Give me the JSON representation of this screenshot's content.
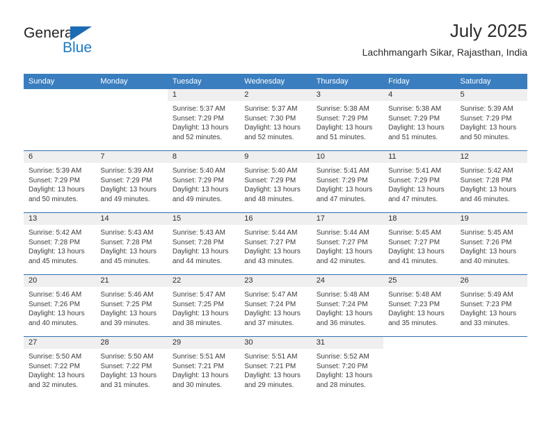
{
  "brand": {
    "name_top": "General",
    "name_bottom": "Blue",
    "accent_color": "#1b7ac4",
    "triangle_color": "#1b6cb5"
  },
  "header": {
    "title": "July 2025",
    "subtitle": "Lachhmangarh Sikar, Rajasthan, India"
  },
  "theme": {
    "header_row_bg": "#3a7ebf",
    "row_divider": "#2f6fae",
    "daynum_band_bg": "#efefef"
  },
  "weekdays": [
    "Sunday",
    "Monday",
    "Tuesday",
    "Wednesday",
    "Thursday",
    "Friday",
    "Saturday"
  ],
  "weeks": [
    [
      {
        "day": "",
        "sunrise": "",
        "sunset": "",
        "daylight_1": "",
        "daylight_2": "",
        "blank": true
      },
      {
        "day": "",
        "sunrise": "",
        "sunset": "",
        "daylight_1": "",
        "daylight_2": "",
        "blank": true
      },
      {
        "day": "1",
        "sunrise": "Sunrise: 5:37 AM",
        "sunset": "Sunset: 7:29 PM",
        "daylight_1": "Daylight: 13 hours",
        "daylight_2": "and 52 minutes."
      },
      {
        "day": "2",
        "sunrise": "Sunrise: 5:37 AM",
        "sunset": "Sunset: 7:30 PM",
        "daylight_1": "Daylight: 13 hours",
        "daylight_2": "and 52 minutes."
      },
      {
        "day": "3",
        "sunrise": "Sunrise: 5:38 AM",
        "sunset": "Sunset: 7:29 PM",
        "daylight_1": "Daylight: 13 hours",
        "daylight_2": "and 51 minutes."
      },
      {
        "day": "4",
        "sunrise": "Sunrise: 5:38 AM",
        "sunset": "Sunset: 7:29 PM",
        "daylight_1": "Daylight: 13 hours",
        "daylight_2": "and 51 minutes."
      },
      {
        "day": "5",
        "sunrise": "Sunrise: 5:39 AM",
        "sunset": "Sunset: 7:29 PM",
        "daylight_1": "Daylight: 13 hours",
        "daylight_2": "and 50 minutes."
      }
    ],
    [
      {
        "day": "6",
        "sunrise": "Sunrise: 5:39 AM",
        "sunset": "Sunset: 7:29 PM",
        "daylight_1": "Daylight: 13 hours",
        "daylight_2": "and 50 minutes."
      },
      {
        "day": "7",
        "sunrise": "Sunrise: 5:39 AM",
        "sunset": "Sunset: 7:29 PM",
        "daylight_1": "Daylight: 13 hours",
        "daylight_2": "and 49 minutes."
      },
      {
        "day": "8",
        "sunrise": "Sunrise: 5:40 AM",
        "sunset": "Sunset: 7:29 PM",
        "daylight_1": "Daylight: 13 hours",
        "daylight_2": "and 49 minutes."
      },
      {
        "day": "9",
        "sunrise": "Sunrise: 5:40 AM",
        "sunset": "Sunset: 7:29 PM",
        "daylight_1": "Daylight: 13 hours",
        "daylight_2": "and 48 minutes."
      },
      {
        "day": "10",
        "sunrise": "Sunrise: 5:41 AM",
        "sunset": "Sunset: 7:29 PM",
        "daylight_1": "Daylight: 13 hours",
        "daylight_2": "and 47 minutes."
      },
      {
        "day": "11",
        "sunrise": "Sunrise: 5:41 AM",
        "sunset": "Sunset: 7:29 PM",
        "daylight_1": "Daylight: 13 hours",
        "daylight_2": "and 47 minutes."
      },
      {
        "day": "12",
        "sunrise": "Sunrise: 5:42 AM",
        "sunset": "Sunset: 7:28 PM",
        "daylight_1": "Daylight: 13 hours",
        "daylight_2": "and 46 minutes."
      }
    ],
    [
      {
        "day": "13",
        "sunrise": "Sunrise: 5:42 AM",
        "sunset": "Sunset: 7:28 PM",
        "daylight_1": "Daylight: 13 hours",
        "daylight_2": "and 45 minutes."
      },
      {
        "day": "14",
        "sunrise": "Sunrise: 5:43 AM",
        "sunset": "Sunset: 7:28 PM",
        "daylight_1": "Daylight: 13 hours",
        "daylight_2": "and 45 minutes."
      },
      {
        "day": "15",
        "sunrise": "Sunrise: 5:43 AM",
        "sunset": "Sunset: 7:28 PM",
        "daylight_1": "Daylight: 13 hours",
        "daylight_2": "and 44 minutes."
      },
      {
        "day": "16",
        "sunrise": "Sunrise: 5:44 AM",
        "sunset": "Sunset: 7:27 PM",
        "daylight_1": "Daylight: 13 hours",
        "daylight_2": "and 43 minutes."
      },
      {
        "day": "17",
        "sunrise": "Sunrise: 5:44 AM",
        "sunset": "Sunset: 7:27 PM",
        "daylight_1": "Daylight: 13 hours",
        "daylight_2": "and 42 minutes."
      },
      {
        "day": "18",
        "sunrise": "Sunrise: 5:45 AM",
        "sunset": "Sunset: 7:27 PM",
        "daylight_1": "Daylight: 13 hours",
        "daylight_2": "and 41 minutes."
      },
      {
        "day": "19",
        "sunrise": "Sunrise: 5:45 AM",
        "sunset": "Sunset: 7:26 PM",
        "daylight_1": "Daylight: 13 hours",
        "daylight_2": "and 40 minutes."
      }
    ],
    [
      {
        "day": "20",
        "sunrise": "Sunrise: 5:46 AM",
        "sunset": "Sunset: 7:26 PM",
        "daylight_1": "Daylight: 13 hours",
        "daylight_2": "and 40 minutes."
      },
      {
        "day": "21",
        "sunrise": "Sunrise: 5:46 AM",
        "sunset": "Sunset: 7:25 PM",
        "daylight_1": "Daylight: 13 hours",
        "daylight_2": "and 39 minutes."
      },
      {
        "day": "22",
        "sunrise": "Sunrise: 5:47 AM",
        "sunset": "Sunset: 7:25 PM",
        "daylight_1": "Daylight: 13 hours",
        "daylight_2": "and 38 minutes."
      },
      {
        "day": "23",
        "sunrise": "Sunrise: 5:47 AM",
        "sunset": "Sunset: 7:24 PM",
        "daylight_1": "Daylight: 13 hours",
        "daylight_2": "and 37 minutes."
      },
      {
        "day": "24",
        "sunrise": "Sunrise: 5:48 AM",
        "sunset": "Sunset: 7:24 PM",
        "daylight_1": "Daylight: 13 hours",
        "daylight_2": "and 36 minutes."
      },
      {
        "day": "25",
        "sunrise": "Sunrise: 5:48 AM",
        "sunset": "Sunset: 7:23 PM",
        "daylight_1": "Daylight: 13 hours",
        "daylight_2": "and 35 minutes."
      },
      {
        "day": "26",
        "sunrise": "Sunrise: 5:49 AM",
        "sunset": "Sunset: 7:23 PM",
        "daylight_1": "Daylight: 13 hours",
        "daylight_2": "and 33 minutes."
      }
    ],
    [
      {
        "day": "27",
        "sunrise": "Sunrise: 5:50 AM",
        "sunset": "Sunset: 7:22 PM",
        "daylight_1": "Daylight: 13 hours",
        "daylight_2": "and 32 minutes."
      },
      {
        "day": "28",
        "sunrise": "Sunrise: 5:50 AM",
        "sunset": "Sunset: 7:22 PM",
        "daylight_1": "Daylight: 13 hours",
        "daylight_2": "and 31 minutes."
      },
      {
        "day": "29",
        "sunrise": "Sunrise: 5:51 AM",
        "sunset": "Sunset: 7:21 PM",
        "daylight_1": "Daylight: 13 hours",
        "daylight_2": "and 30 minutes."
      },
      {
        "day": "30",
        "sunrise": "Sunrise: 5:51 AM",
        "sunset": "Sunset: 7:21 PM",
        "daylight_1": "Daylight: 13 hours",
        "daylight_2": "and 29 minutes."
      },
      {
        "day": "31",
        "sunrise": "Sunrise: 5:52 AM",
        "sunset": "Sunset: 7:20 PM",
        "daylight_1": "Daylight: 13 hours",
        "daylight_2": "and 28 minutes."
      },
      {
        "day": "",
        "sunrise": "",
        "sunset": "",
        "daylight_1": "",
        "daylight_2": "",
        "blank": true
      },
      {
        "day": "",
        "sunrise": "",
        "sunset": "",
        "daylight_1": "",
        "daylight_2": "",
        "blank": true
      }
    ]
  ]
}
